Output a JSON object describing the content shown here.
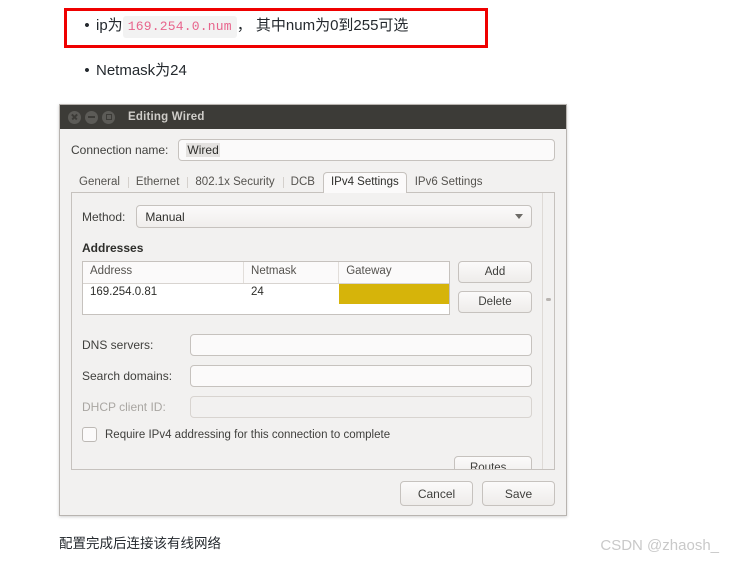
{
  "notes": {
    "ip_line": {
      "bullet": "•",
      "prefix": "ip为",
      "code": "169.254.0.num",
      "suffix": "， 其中num为0到255可选"
    },
    "netmask_line": {
      "bullet": "•",
      "text": "Netmask为24"
    },
    "highlight_color": "#ef0000",
    "code_color": "#e8648c"
  },
  "dialog": {
    "title": "Editing Wired",
    "window_buttons": [
      "close-icon",
      "minimize-icon",
      "maximize-icon"
    ],
    "connection_name": {
      "label": "Connection name:",
      "value": "Wired"
    },
    "tabs": [
      {
        "label": "General",
        "active": false
      },
      {
        "label": "Ethernet",
        "active": false
      },
      {
        "label": "802.1x Security",
        "active": false
      },
      {
        "label": "DCB",
        "active": false
      },
      {
        "label": "IPv4 Settings",
        "active": true
      },
      {
        "label": "IPv6 Settings",
        "active": false
      }
    ],
    "method": {
      "label": "Method:",
      "value": "Manual"
    },
    "addresses": {
      "heading": "Addresses",
      "columns": [
        "Address",
        "Netmask",
        "Gateway"
      ],
      "rows": [
        {
          "address": "169.254.0.81",
          "netmask": "24",
          "gateway": ""
        }
      ],
      "gateway_highlight_color": "#d6b40a",
      "add_label": "Add",
      "delete_label": "Delete"
    },
    "fields": [
      {
        "label": "DNS servers:",
        "value": "",
        "disabled": false
      },
      {
        "label": "Search domains:",
        "value": "",
        "disabled": false
      },
      {
        "label": "DHCP client ID:",
        "value": "",
        "disabled": true
      }
    ],
    "require_checkbox": {
      "label": "Require IPv4 addressing for this connection to complete",
      "checked": false
    },
    "routes_label": "Routes...",
    "footer": {
      "cancel_label": "Cancel",
      "save_label": "Save"
    }
  },
  "caption": "配置完成后连接该有线网络",
  "watermark": "CSDN @zhaosh_"
}
